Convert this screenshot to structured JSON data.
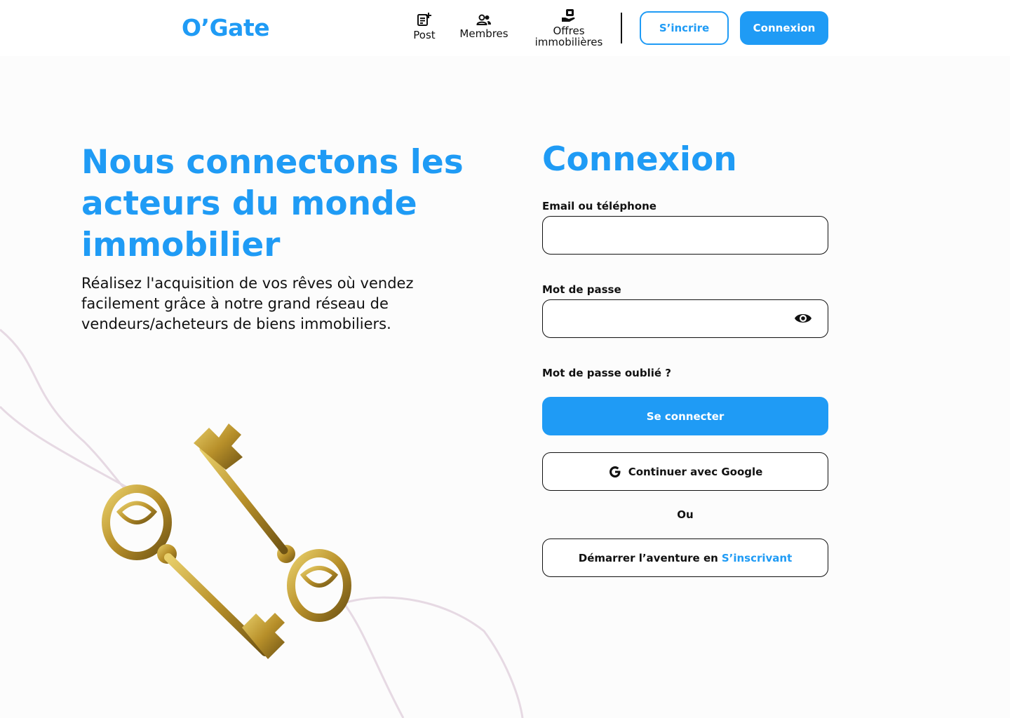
{
  "brand": {
    "logo": "O’Gate",
    "accent": "#1f9bf5"
  },
  "nav": {
    "items": [
      {
        "label": "Post",
        "icon": "post-add-icon"
      },
      {
        "label": "Membres",
        "icon": "members-icon"
      },
      {
        "label_line1": "Offres",
        "label_line2": "immobilières",
        "icon": "property-offer-icon"
      }
    ],
    "signup_label": "S’incrire",
    "login_label": "Connexion"
  },
  "hero": {
    "title": "Nous connectons les acteurs du monde immobilier",
    "subtitle": "Réalisez l'acquisition de vos rêves où vendez facilement grâce à notre grand réseau de vendeurs/acheteurs de biens immobiliers."
  },
  "login_form": {
    "title": "Connexion",
    "email_label": "Email ou téléphone",
    "email_value": "",
    "password_label": "Mot de passe",
    "password_value": "",
    "forgot_label": "Mot de passe oublié ?",
    "submit_label": "Se connecter",
    "google_label": "Continuer avec Google",
    "or_label": "Ou",
    "signup_prefix": "Démarrer l’aventure en",
    "signup_link": "S’inscrivant"
  }
}
